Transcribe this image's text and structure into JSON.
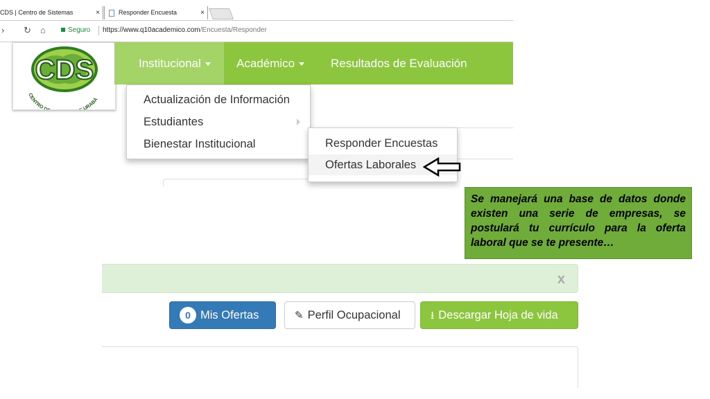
{
  "browser": {
    "tabs": [
      {
        "label": "CDS | Centro de Sistemas",
        "close": "×"
      },
      {
        "label": "Responder Encuesta",
        "close": "×"
      }
    ],
    "secure_label": "Seguro",
    "url_host": "https://www.q10academico.com",
    "url_path": "/Encuesta/Responder"
  },
  "logo": {
    "text": "CDS",
    "ring_text": "CENTRO DE SISTEMAS DE URABÁ"
  },
  "navbar": {
    "items": [
      {
        "label": "Institucional"
      },
      {
        "label": "Académico"
      },
      {
        "label": "Resultados de Evaluación"
      }
    ]
  },
  "menu_institucional": {
    "items": [
      {
        "label": "Actualización de Información"
      },
      {
        "label": "Estudiantes"
      },
      {
        "label": "Bienestar Institucional"
      }
    ]
  },
  "submenu_bienestar": {
    "items": [
      {
        "label": "Responder Encuestas"
      },
      {
        "label": "Ofertas Laborales"
      }
    ]
  },
  "annotation": {
    "text": "Se manejará una base de datos donde existen una serie de empresas, se postulará tu currículo para la oferta laboral que se te presente…"
  },
  "alert": {
    "close_label": "x"
  },
  "actions": {
    "mis_ofertas_count": "0",
    "mis_ofertas_label": "Mis Ofertas",
    "perfil_label": "Perfil Ocupacional",
    "descargar_label": "Descargar Hoja de vida"
  },
  "colors": {
    "brand_green": "#8cc63f",
    "primary_blue": "#337ab7",
    "alert_bg": "#dff0d8",
    "annotation_bg": "#6fac3a"
  }
}
